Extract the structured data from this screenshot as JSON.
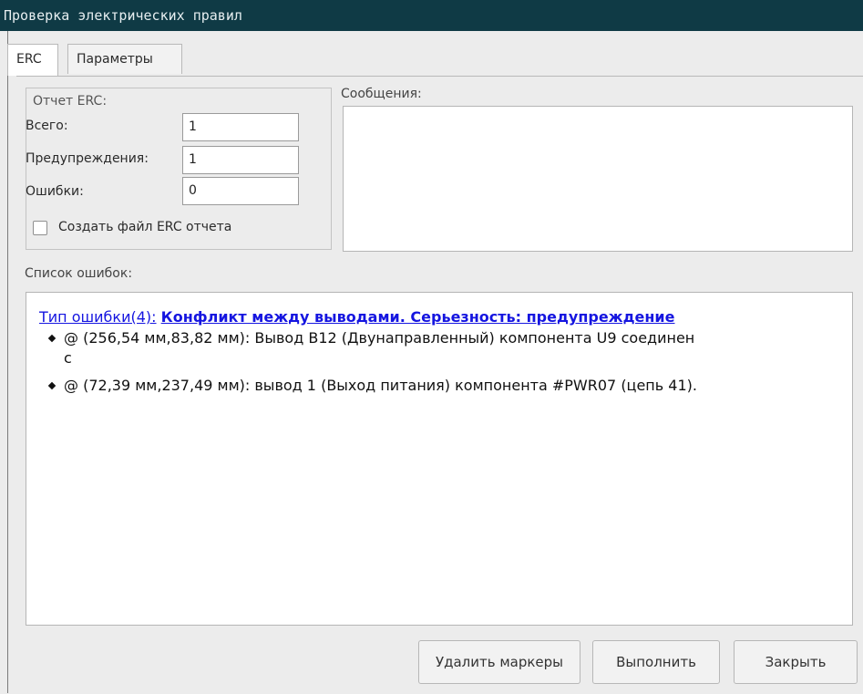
{
  "window": {
    "title": "Проверка электрических правил"
  },
  "tabs": [
    {
      "label": "ERC",
      "active": true
    },
    {
      "label": "Параметры",
      "active": false
    }
  ],
  "report": {
    "group_label": "Отчет ERC:",
    "total_label": "Всего:",
    "total_value": "1",
    "warnings_label": "Предупреждения:",
    "warnings_value": "1",
    "errors_label": "Ошибки:",
    "errors_value": "0",
    "create_file_label": "Создать файл ERC отчета",
    "create_file_checked": false
  },
  "messages": {
    "label": "Сообщения:",
    "content": ""
  },
  "error_list": {
    "label": "Список ошибок:",
    "items": [
      {
        "type_text": "Тип ошибки(4):",
        "title": "Конфликт между выводами. Серьезность: предупреждение",
        "lines": [
          "@ (256,54 мм,83,82 мм): Вывод B12 (Двунаправленный) компонента U9 соединен",
          "с",
          "@ (72,39 мм,237,49 мм): вывод 1 (Выход питания) компонента #PWR07 (цепь 41)."
        ]
      }
    ]
  },
  "buttons": {
    "delete_markers": "Удалить маркеры",
    "run": "Выполнить",
    "close": "Закрыть"
  },
  "colors": {
    "titlebar": "#0f3a45",
    "link": "#1515e0",
    "background": "#ececec"
  }
}
